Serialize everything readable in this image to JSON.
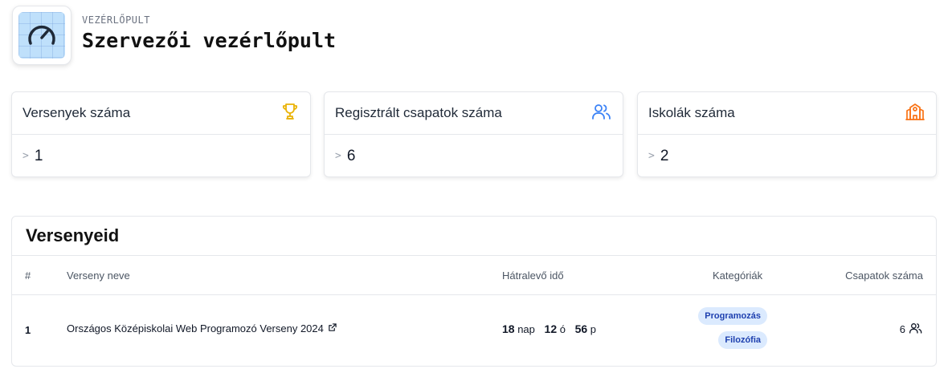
{
  "header": {
    "eyebrow": "VEZÉRLŐPULT",
    "title": "Szervezői vezérlőpult",
    "icon": "speedometer-icon"
  },
  "stats": [
    {
      "label": "Versenyek száma",
      "value": "1",
      "icon": "trophy-icon",
      "color": "#eab308"
    },
    {
      "label": "Regisztrált csapatok száma",
      "value": "6",
      "icon": "users-icon",
      "color": "#3b82f6"
    },
    {
      "label": "Iskolák száma",
      "value": "2",
      "icon": "school-icon",
      "color": "#f97316"
    }
  ],
  "stat_prefix": ">",
  "competitions": {
    "title": "Versenyeid",
    "columns": {
      "index": "#",
      "name": "Verseny neve",
      "remaining": "Hátralevő idő",
      "categories": "Kategóriák",
      "teams": "Csapatok száma"
    },
    "rows": [
      {
        "index": "1",
        "name": "Országos Középiskolai Web Programozó Verseny 2024",
        "remaining": {
          "days": "18",
          "days_unit": "nap",
          "hours": "12",
          "hours_unit": "ó",
          "minutes": "56",
          "minutes_unit": "p"
        },
        "categories": [
          "Programozás",
          "Filozófia"
        ],
        "teams": "6"
      }
    ]
  },
  "colors": {
    "badge_bg": "#dbeafe",
    "badge_text": "#1e40af"
  }
}
